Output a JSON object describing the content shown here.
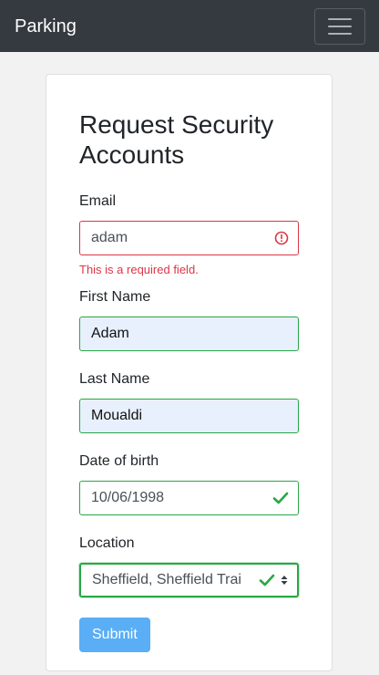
{
  "navbar": {
    "brand": "Parking",
    "menu_icon": "hamburger-menu-icon"
  },
  "form": {
    "title": "Request Security Accounts",
    "email": {
      "label": "Email",
      "value": "adam",
      "error": "This is a required field.",
      "status_icon": "error-circle-icon"
    },
    "first_name": {
      "label": "First Name",
      "value": "Adam"
    },
    "last_name": {
      "label": "Last Name",
      "value": "Moualdi"
    },
    "dob": {
      "label": "Date of birth",
      "value": "10/06/1998",
      "status_icon": "check-icon"
    },
    "location": {
      "label": "Location",
      "value": "Sheffield, Sheffield Train Station",
      "status_icon": "check-icon"
    },
    "submit_label": "Submit"
  },
  "colors": {
    "navbar_bg": "#343a40",
    "error": "#dc3545",
    "valid": "#28a745",
    "autofill_bg": "#e8f0fe",
    "primary_disabled": "#5aaef5"
  }
}
